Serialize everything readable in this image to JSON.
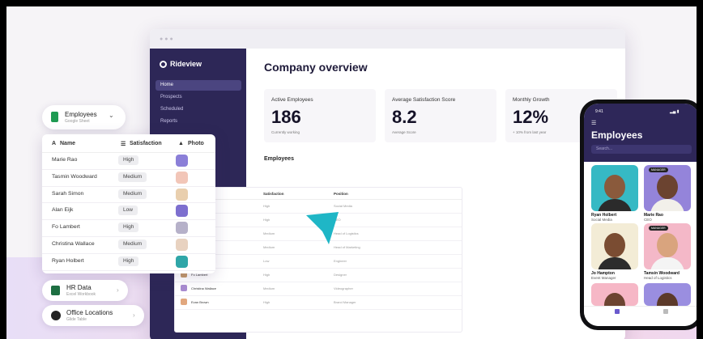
{
  "colors": {
    "sidebar": "#2d2757",
    "accent": "#1fb6c6",
    "sheet_green": "#1e9a52",
    "excel_green": "#1d6f42"
  },
  "desktop": {
    "brand": "Rideview",
    "nav": [
      "Home",
      "Prospects",
      "Scheduled",
      "Reports"
    ],
    "page_title": "Company overview",
    "cards": [
      {
        "label": "Active Employees",
        "value": "186",
        "sub": "Currently working"
      },
      {
        "label": "Average Satisfaction Score",
        "value": "8.2",
        "sub": "Average Score"
      },
      {
        "label": "Monthly Growth",
        "value": "12%",
        "sub": "+ 10% from last year"
      }
    ],
    "section_title": "Employees",
    "table": {
      "headers": [
        "Name",
        "Satisfaction",
        "Position"
      ],
      "rows": [
        {
          "name": "Ryan Holbert",
          "sat": "High",
          "pos": "Social Media"
        },
        {
          "name": "Marie Rr",
          "sat": "High",
          "pos": "CEO"
        },
        {
          "name": "Tasmin Wo",
          "sat": "Medium",
          "pos": "Head of Logistics"
        },
        {
          "name": "Sarah Simon",
          "sat": "Medium",
          "pos": "Head of Marketing"
        },
        {
          "name": "Alan Eijk",
          "sat": "Low",
          "pos": "Engineer"
        },
        {
          "name": "Fo Lambert",
          "sat": "High",
          "pos": "Designer"
        },
        {
          "name": "Christina Wallace",
          "sat": "Medium",
          "pos": "Videographer"
        },
        {
          "name": "Evan Brown",
          "sat": "High",
          "pos": "Brand Manager"
        }
      ]
    }
  },
  "source_pill": {
    "title": "Employees",
    "subtitle": "Google Sheet"
  },
  "panel": {
    "headers": [
      "Name",
      "Satisfaction",
      "Photo"
    ],
    "rows": [
      {
        "name": "Marie Rao",
        "sat": "High"
      },
      {
        "name": "Tasmin Woodward",
        "sat": "Medium"
      },
      {
        "name": "Sarah Simon",
        "sat": "Medium"
      },
      {
        "name": "Alan Eijk",
        "sat": "Low"
      },
      {
        "name": "Fo Lambert",
        "sat": "High"
      },
      {
        "name": "Christina Wallace",
        "sat": "Medium"
      },
      {
        "name": "Ryan Holbert",
        "sat": "High"
      }
    ]
  },
  "sources": [
    {
      "title": "HR Data",
      "subtitle": "Excel Workbook"
    },
    {
      "title": "Office Locations",
      "subtitle": "Glide Table"
    }
  ],
  "phone": {
    "time": "9:41",
    "title": "Employees",
    "search_placeholder": "Search...",
    "cards": [
      {
        "name": "Ryan Holbert",
        "role": "Social Media",
        "tag": ""
      },
      {
        "name": "Marie Rao",
        "role": "CEO",
        "tag": "MANAGER"
      },
      {
        "name": "Jo Hampton",
        "role": "Event Manager",
        "tag": ""
      },
      {
        "name": "Tamsin Woodward",
        "role": "Head of Logistics",
        "tag": "MANAGER"
      }
    ]
  }
}
